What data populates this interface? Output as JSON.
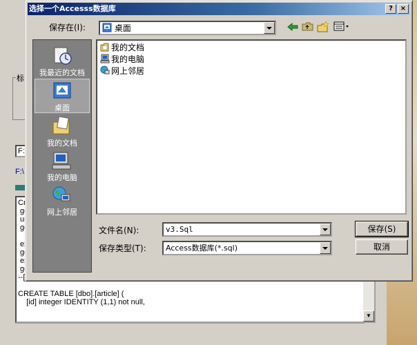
{
  "background_window": {
    "group_label": "标",
    "path_value": "F:\\",
    "path_link": "F:\\",
    "script_lines": [
      {
        "text": "Cr"
      },
      {
        "text": " go"
      },
      {
        "text": " us"
      },
      {
        "text": " go"
      },
      {
        "text": ""
      },
      {
        "text": " ex"
      },
      {
        "text": " go"
      },
      {
        "text": " ex"
      },
      {
        "text": " go"
      },
      {
        "text": "--[article]:"
      },
      {
        "text": ""
      },
      {
        "text": "CREATE TABLE [dbo].[article] ("
      },
      {
        "text": "    [id] integer IDENTITY (1,1) not null,"
      }
    ]
  },
  "dialog": {
    "title": "选择一个Accesss数据库",
    "title_buttons": {
      "help": "?",
      "close": "×"
    },
    "save_in_label": "保存在(I):",
    "save_in_value": "桌面",
    "places": [
      {
        "label": "我最近的文档",
        "icon": "recent-documents-icon"
      },
      {
        "label": "桌面",
        "icon": "desktop-icon",
        "selected": true
      },
      {
        "label": "我的文档",
        "icon": "my-documents-icon"
      },
      {
        "label": "我的电脑",
        "icon": "my-computer-icon"
      },
      {
        "label": "网上邻居",
        "icon": "network-places-icon"
      }
    ],
    "files": [
      {
        "name": "我的文档",
        "icon": "folder-documents-icon"
      },
      {
        "name": "我的电脑",
        "icon": "computer-icon"
      },
      {
        "name": "网上邻居",
        "icon": "network-icon"
      }
    ],
    "filename_label": "文件名(N):",
    "filename_value": "v3.Sql",
    "filetype_label": "保存类型(T):",
    "filetype_value": "Access数据库(*.sql)",
    "save_button": "保存(S)",
    "cancel_button": "取消"
  }
}
